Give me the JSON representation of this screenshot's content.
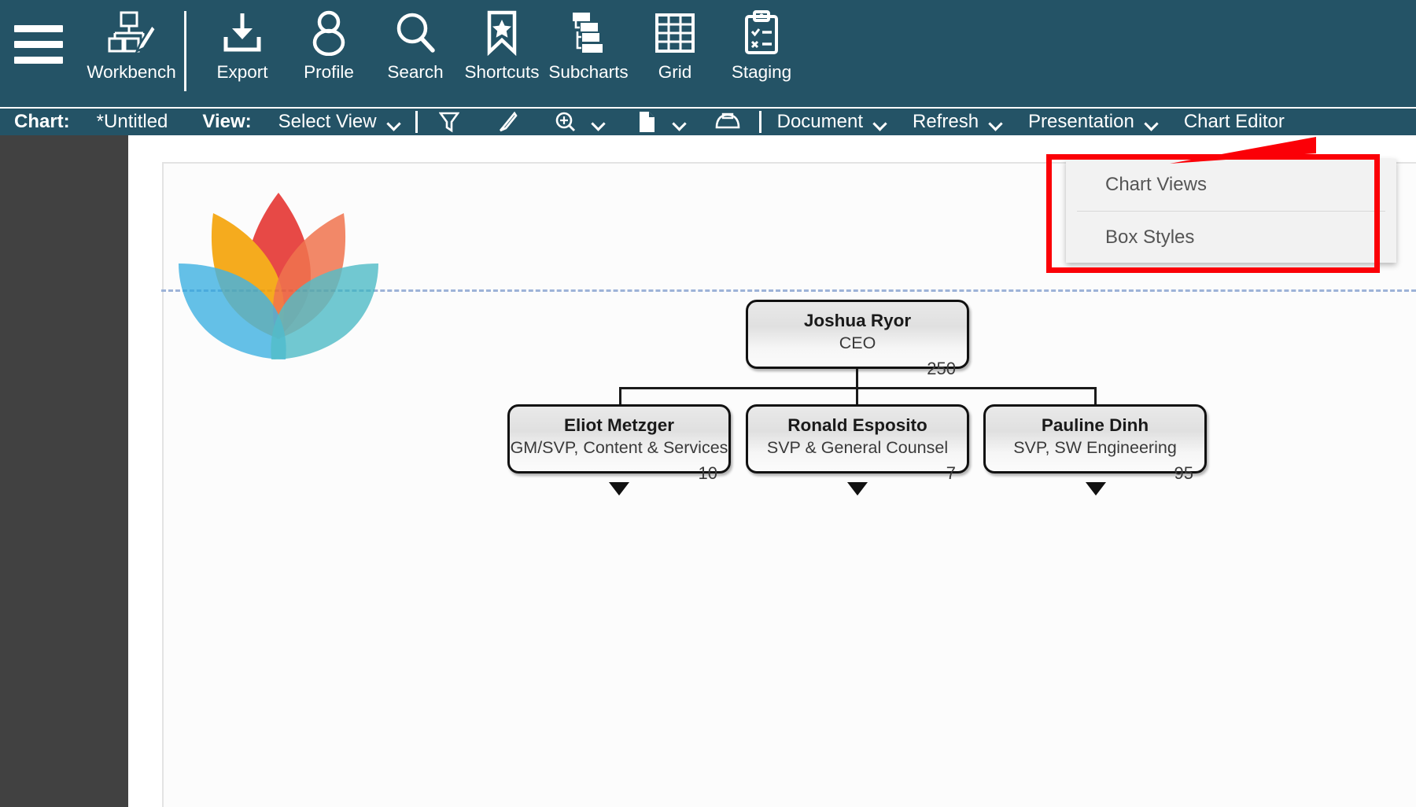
{
  "toolbar": {
    "menu_icon": "hamburger-menu-icon",
    "items": [
      {
        "label": "Workbench",
        "icon": "workbench-icon"
      },
      {
        "label": "Export",
        "icon": "export-download-icon"
      },
      {
        "label": "Profile",
        "icon": "profile-person-icon"
      },
      {
        "label": "Search",
        "icon": "search-magnifier-icon"
      },
      {
        "label": "Shortcuts",
        "icon": "bookmark-star-icon"
      },
      {
        "label": "Subcharts",
        "icon": "subcharts-hierarchy-icon"
      },
      {
        "label": "Grid",
        "icon": "grid-table-icon"
      },
      {
        "label": "Staging",
        "icon": "staging-clipboard-icon"
      }
    ]
  },
  "subtoolbar": {
    "chart_label": "Chart:",
    "chart_value": "*Untitled",
    "view_label": "View:",
    "view_value": "Select View",
    "icons": [
      {
        "name": "filter-funnel-icon"
      },
      {
        "name": "highlighter-pen-icon"
      },
      {
        "name": "zoom-in-icon"
      },
      {
        "name": "page-document-icon"
      },
      {
        "name": "print-icon"
      }
    ],
    "menus": [
      {
        "label": "Document"
      },
      {
        "label": "Refresh"
      },
      {
        "label": "Presentation"
      },
      {
        "label": "Chart Editor"
      }
    ]
  },
  "presentation_menu": {
    "items": [
      {
        "label": "Chart Views"
      },
      {
        "label": "Box Styles"
      }
    ]
  },
  "annotation": {
    "color": "#fb0007",
    "type": "red-highlight-box"
  },
  "colors": {
    "toolbar_bg": "#245366",
    "sidebar_bg": "#414141",
    "canvas_bg": "#ffffff",
    "guide_line": "#9db3d8",
    "node_border": "#111111",
    "annotation": "#fb0007"
  },
  "logo": {
    "name": "lotus-flower-logo",
    "petals": [
      "#e8332f",
      "#f59b00",
      "#ef6236",
      "#29a8df",
      "#2fab9a",
      "#3bb4c1"
    ]
  },
  "chart_data": {
    "type": "org-chart",
    "title": "*Untitled",
    "nodes": [
      {
        "id": "ceo",
        "name": "Joshua Ryor",
        "title": "CEO",
        "count": "250",
        "level": 0,
        "has_children": false
      },
      {
        "id": "c1",
        "name": "Eliot Metzger",
        "title": "GM/SVP, Content & Services",
        "count": "10",
        "level": 1,
        "has_children": true
      },
      {
        "id": "c2",
        "name": "Ronald Esposito",
        "title": "SVP & General Counsel",
        "count": "7",
        "level": 1,
        "has_children": true
      },
      {
        "id": "c3",
        "name": "Pauline Dinh",
        "title": "SVP, SW Engineering",
        "count": "95",
        "level": 1,
        "has_children": true
      }
    ],
    "edges": [
      {
        "from": "ceo",
        "to": "c1"
      },
      {
        "from": "ceo",
        "to": "c2"
      },
      {
        "from": "ceo",
        "to": "c3"
      }
    ]
  }
}
